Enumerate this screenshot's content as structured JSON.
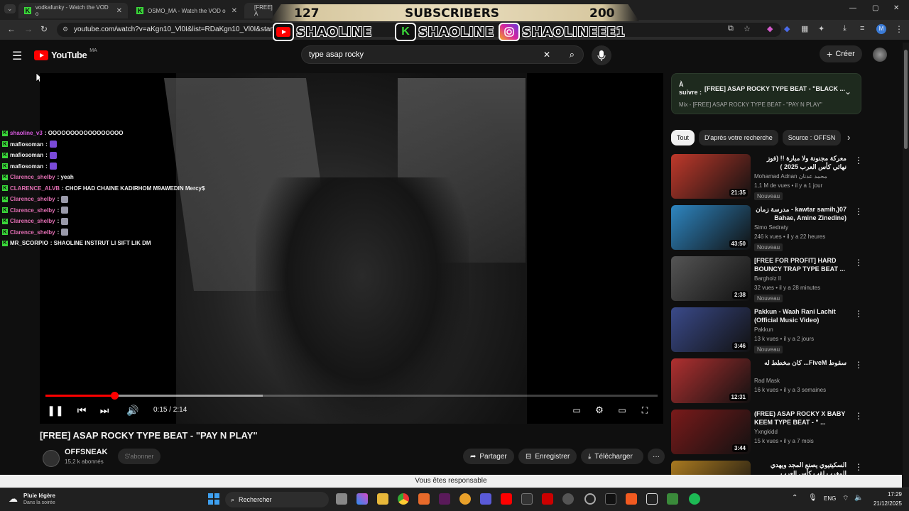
{
  "browser": {
    "tabs": [
      {
        "title": "vodkafunky - Watch the VOD o"
      },
      {
        "title": "OSMO_MA - Watch the VOD o"
      },
      {
        "title": "[FREE] A"
      }
    ],
    "url": "youtube.com/watch?v=aKgn10_Vl0I&list=RDaKgn10_Vl0I&start_ra"
  },
  "overlay": {
    "subs_current": "127",
    "subs_label": "SUBSCRIBERS",
    "subs_goal": "200",
    "brand_youtube": "SHAOLINE",
    "brand_kick": "SHAOLINE",
    "brand_instagram": "SHAOLINEEE1"
  },
  "youtube": {
    "logo_text": "YouTube",
    "region": "MA",
    "search_value": "type asap rocky",
    "create_label": "Créer"
  },
  "chat": [
    {
      "user": "shaoline_v3",
      "msg": ": OOOOOOOOOOOOOOOOO",
      "color": "#d85adf"
    },
    {
      "user": "mafiosoman",
      "msg": ":",
      "color": "#f1f1f1",
      "emote": true
    },
    {
      "user": "mafiosoman",
      "msg": ":",
      "color": "#f1f1f1",
      "emote": true
    },
    {
      "user": "mafiosoman",
      "msg": ":",
      "color": "#f1f1f1",
      "emote": true
    },
    {
      "user": "Clarence_shelby",
      "msg": ": yeah",
      "color": "#e26fb3"
    },
    {
      "user": "CLARENCE_ALVB",
      "msg": ": CHOF HAD CHAINE KADIRHOM M9AWEDIN Mercy$",
      "color": "#e26fb3"
    },
    {
      "user": "Clarence_shelby",
      "msg": ":",
      "color": "#e26fb3",
      "emote2": true
    },
    {
      "user": "Clarence_shelby",
      "msg": ":",
      "color": "#e26fb3",
      "emote2": true
    },
    {
      "user": "Clarence_shelby",
      "msg": ":",
      "color": "#e26fb3",
      "emote2": true
    },
    {
      "user": "Clarence_shelby",
      "msg": ":",
      "color": "#e26fb3",
      "emote2": true
    },
    {
      "user": "MR_SCORPIO",
      "msg": ": SHAOLINE INSTRUT LI SIFT LIK DM",
      "color": "#f1f1f1"
    }
  ],
  "player": {
    "time": "0:15 / 2:14",
    "progress": 0.112,
    "buffered": 0.355
  },
  "video": {
    "title": "[FREE] ASAP ROCKY TYPE BEAT - \"PAY N PLAY\"",
    "channel": "OFFSNEAK",
    "subscribers": "15,2 k abonnés",
    "subscribe_label": "S'abonner",
    "share_label": "Partager",
    "save_label": "Enregistrer",
    "download_label": "Télécharger"
  },
  "up_next": {
    "prefix": "À suivre :",
    "title": "[FREE] ASAP ROCKY TYPE BEAT - \"BLACK ...",
    "mix": "Mix - [FREE] ASAP ROCKY TYPE BEAT - \"PAY N PLAY\""
  },
  "chips": [
    "Tout",
    "D'après votre recherche",
    "Source : OFFSN"
  ],
  "recommendations": [
    {
      "title": "معركة مجنونة ولا مبارة !! (فوز نهائي كأس العرب 2025 )",
      "channel": "Mohamad Adnan محمد عدنان",
      "meta": "1,1 M de vues • il y a 1 jour",
      "badge": "Nouveau",
      "duration": "21:35",
      "thumb": "#c0392b"
    },
    {
      "title": "kawtar samih,)07 - مدرسة زمان (Bahae, Amine Zinedine",
      "channel": "Simo Sedraty",
      "meta": "246 k vues • il y a 22 heures",
      "badge": "Nouveau",
      "duration": "43:50",
      "thumb": "#2e86c1"
    },
    {
      "title": "[FREE FOR PROFIT] HARD BOUNCY TRAP TYPE BEAT ...",
      "channel": "Bargholz II",
      "meta": "32 vues • il y a 28 minutes",
      "badge": "Nouveau",
      "duration": "2:38",
      "thumb": "#555555"
    },
    {
      "title": "Pakkun - Waah Rani Lachit (Official Music Video)",
      "channel": "Pakkun",
      "meta": "13 k vues • il y a 2 jours",
      "badge": "Nouveau",
      "duration": "3:46",
      "thumb": "#3a4a8a"
    },
    {
      "title": "سقوط FiveM... كان مخطط له",
      "channel": "Rad Mask",
      "meta": "16 k vues • il y a 3 semaines",
      "badge": "",
      "duration": "12:31",
      "thumb": "#b03030"
    },
    {
      "title": "(FREE) ASAP ROCKY X BABY KEEM TYPE BEAT - \" ...",
      "channel": "Yxngkidd",
      "meta": "15 k vues • il y a 7 mois",
      "badge": "",
      "duration": "3:44",
      "thumb": "#7a1a1a"
    },
    {
      "title": "السكيتيوي يصنع المجد ويهدي المغرب لقب كأس العرب",
      "channel": "",
      "meta": "",
      "badge": "",
      "duration": "",
      "thumb": "#aa7a20"
    }
  ],
  "notification": "Vous êtes responsable",
  "taskbar": {
    "weather": "Pluie légère",
    "weather_sub": "Dans la soirée",
    "search": "Rechercher",
    "lang": "ENG",
    "time": "17:29",
    "date": "21/12/2025"
  },
  "colors": {
    "youtube_red": "#ff0000",
    "kick_green": "#3ad83a",
    "bg": "#0f0f0f"
  }
}
